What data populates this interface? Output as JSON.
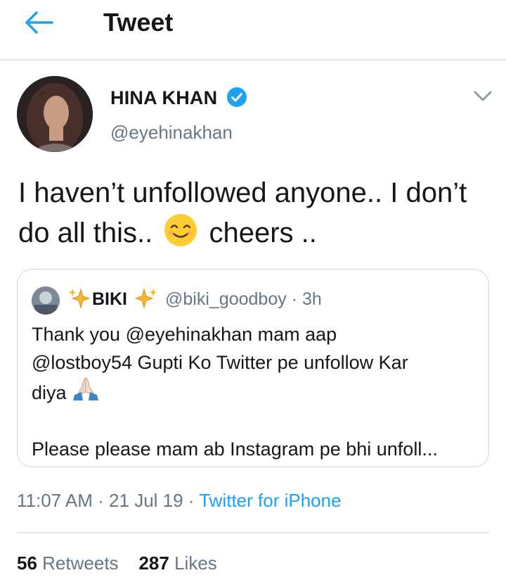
{
  "header": {
    "title": "Tweet",
    "back_icon": "arrow-left-icon"
  },
  "tweet": {
    "author_name": "HINA KHAN",
    "author_handle": "@eyehinakhan",
    "verified": true,
    "text_before_emoji": "I haven’t unfollowed anyone.. I don’t do all this..",
    "emoji": "smiling-face-with-smiling-eyes",
    "text_after_emoji": "cheers .."
  },
  "quote": {
    "author_name": "BIKI",
    "name_decoration": "sparkles",
    "handle": "@biki_goodboy",
    "time": "· 3h",
    "line1": "Thank you @eyehinakhan mam aap",
    "line2": "@lostboy54 Gupti Ko Twitter pe unfollow Kar",
    "line3": "diya",
    "emoji": "folded-hands",
    "line4": "Please please mam ab Instagram pe bhi unfoll..."
  },
  "meta": {
    "time": "11:07 AM",
    "date": "21 Jul 19",
    "separator": " · ",
    "source": "Twitter for iPhone"
  },
  "stats": {
    "retweets_count": "56",
    "retweets_label": "Retweets",
    "likes_count": "287",
    "likes_label": "Likes"
  },
  "colors": {
    "accent": "#1da1f2",
    "secondary_text": "#657786",
    "border": "#e1e8ed",
    "emoji_yellow": "#ffcc33"
  }
}
